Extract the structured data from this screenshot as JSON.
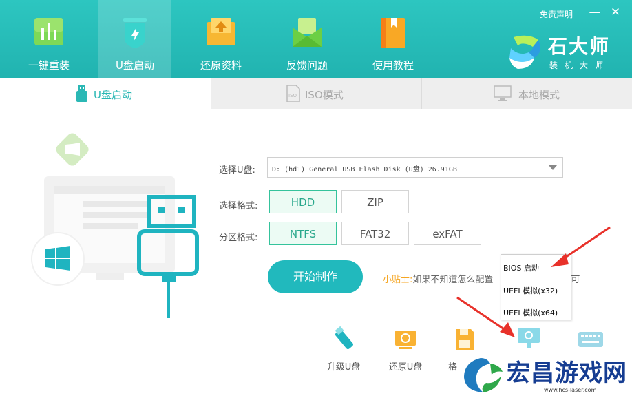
{
  "header": {
    "nav": [
      {
        "label": "一键重装",
        "icon": "bar-chart-icon"
      },
      {
        "label": "U盘启动",
        "icon": "usb-shield-icon"
      },
      {
        "label": "还原资料",
        "icon": "restore-folder-icon"
      },
      {
        "label": "反馈问题",
        "icon": "mail-icon"
      },
      {
        "label": "使用教程",
        "icon": "book-icon"
      }
    ],
    "disclaimer": "免责声明",
    "minimize": "—",
    "close": "✕",
    "logo": {
      "title": "石大师",
      "subtitle": "装机大师"
    }
  },
  "tabs": [
    {
      "label": "U盘启动",
      "icon": "usb-stick-icon",
      "active": true
    },
    {
      "label": "ISO模式",
      "icon": "iso-file-icon",
      "active": false
    },
    {
      "label": "本地模式",
      "icon": "monitor-icon",
      "active": false
    }
  ],
  "form": {
    "select_usb_label": "选择U盘:",
    "usb_value": "D: (hd1) General USB Flash Disk  (U盘) 26.91GB",
    "format_label": "选择格式:",
    "format_options": [
      "HDD",
      "ZIP"
    ],
    "format_selected": "HDD",
    "partition_label": "分区格式:",
    "partition_options": [
      "NTFS",
      "FAT32",
      "exFAT"
    ],
    "partition_selected": "NTFS",
    "start_button": "开始制作",
    "tip_label": "小贴士:",
    "tip_text": "如果不知道怎么配置",
    "tip_tail": "即可"
  },
  "tools": [
    {
      "label": "升级U盘",
      "icon": "usb-upgrade-icon"
    },
    {
      "label": "还原U盘",
      "icon": "usb-restore-icon"
    },
    {
      "label": "格",
      "icon": "floppy-icon"
    }
  ],
  "popup_menu": [
    "BIOS 启动",
    "UEFI 模拟(x32)",
    "UEFI 模拟(x64)"
  ],
  "watermark": {
    "title": "宏昌游戏网",
    "url": "www.hcs-laser.com"
  },
  "colors": {
    "header": "#2dc6c0",
    "accent": "#21b9bd",
    "selected_border": "#35c39c",
    "arrow": "#e8312a"
  }
}
